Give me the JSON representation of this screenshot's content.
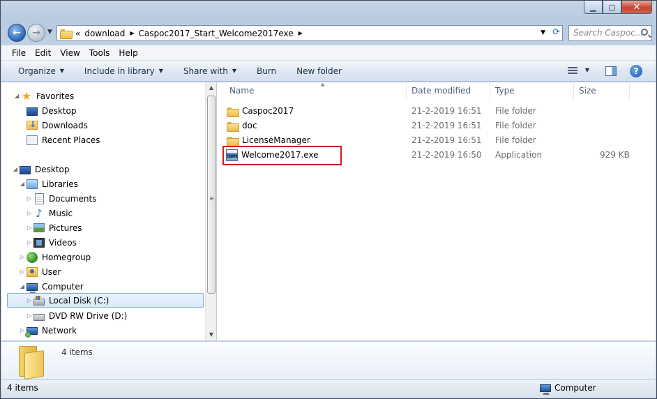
{
  "window": {
    "min_glyph": "▁",
    "max_glyph": "▢",
    "close_glyph": "✕"
  },
  "nav": {
    "back_glyph": "←",
    "forward_glyph": "→",
    "breadcrumb_prefix": "«",
    "breadcrumb": [
      "download",
      "Caspoc2017_Start_Welcome2017exe"
    ],
    "search_placeholder": "Search Caspoc..."
  },
  "menu": [
    "File",
    "Edit",
    "View",
    "Tools",
    "Help"
  ],
  "toolbar": {
    "organize": "Organize",
    "include_in_library": "Include in library",
    "share_with": "Share with",
    "burn": "Burn",
    "new_folder": "New folder",
    "help_glyph": "?"
  },
  "sidebar": {
    "items": [
      {
        "label": "Favorites",
        "icon": "star-icon",
        "expander": "expanded"
      },
      {
        "label": "Desktop",
        "icon": "desktop-icon",
        "expander": "none"
      },
      {
        "label": "Downloads",
        "icon": "downloads-icon",
        "expander": "none"
      },
      {
        "label": "Recent Places",
        "icon": "recent-places-icon",
        "expander": "none"
      },
      {
        "label": "Desktop",
        "icon": "desktop-icon",
        "expander": "expanded"
      },
      {
        "label": "Libraries",
        "icon": "libraries-icon",
        "expander": "expanded"
      },
      {
        "label": "Documents",
        "icon": "documents-icon",
        "expander": "collapsed"
      },
      {
        "label": "Music",
        "icon": "music-icon",
        "expander": "collapsed"
      },
      {
        "label": "Pictures",
        "icon": "pictures-icon",
        "expander": "collapsed"
      },
      {
        "label": "Videos",
        "icon": "videos-icon",
        "expander": "collapsed"
      },
      {
        "label": "Homegroup",
        "icon": "homegroup-icon",
        "expander": "collapsed"
      },
      {
        "label": "User",
        "icon": "user-folder-icon",
        "expander": "collapsed"
      },
      {
        "label": "Computer",
        "icon": "computer-icon",
        "expander": "expanded"
      },
      {
        "label": "Local Disk (C:)",
        "icon": "local-disk-icon",
        "expander": "collapsed",
        "selected": true
      },
      {
        "label": "DVD RW Drive (D:)",
        "icon": "dvd-drive-icon",
        "expander": "collapsed"
      },
      {
        "label": "Network",
        "icon": "network-icon",
        "expander": "collapsed"
      }
    ]
  },
  "files": {
    "columns": [
      "Name",
      "Date modified",
      "Type",
      "Size"
    ],
    "sort_column": "Name",
    "rows": [
      {
        "name": "Caspoc2017",
        "date": "21-2-2019 16:51",
        "type": "File folder",
        "size": "",
        "icon": "folder-icon"
      },
      {
        "name": "doc",
        "date": "21-2-2019 16:51",
        "type": "File folder",
        "size": "",
        "icon": "folder-icon"
      },
      {
        "name": "LicenseManager",
        "date": "21-2-2019 16:51",
        "type": "File folder",
        "size": "",
        "icon": "folder-icon"
      },
      {
        "name": "Welcome2017.exe",
        "date": "21-2-2019 16:50",
        "type": "Application",
        "size": "929 KB",
        "icon": "caspoc-exe-icon",
        "highlighted": true
      }
    ]
  },
  "details": {
    "text": "4 items"
  },
  "status": {
    "left": "4 items",
    "right": "Computer"
  },
  "colors": {
    "highlight_border": "#d6171f",
    "selection_border": "#84acdd"
  }
}
